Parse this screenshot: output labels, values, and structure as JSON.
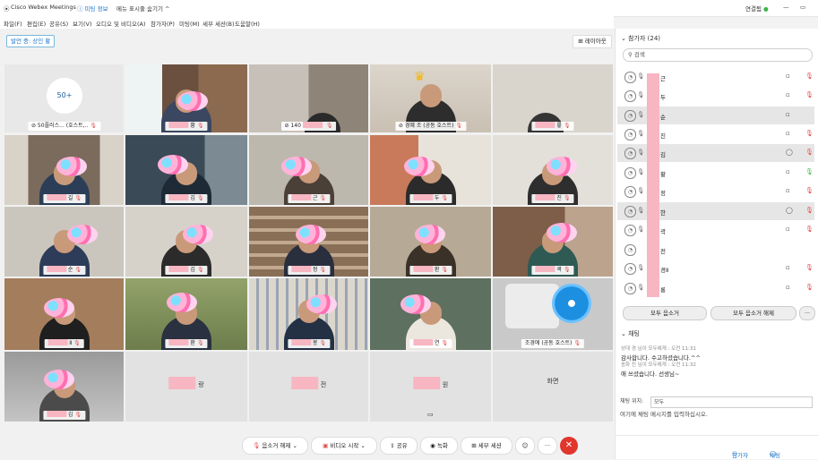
{
  "titlebar": {
    "app": "Cisco Webex Meetings",
    "meeting_info": "미팅 정보",
    "hide_menu": "메뉴 표시줄 숨기기 ^",
    "connection": "연결됨",
    "minimize": "—",
    "maximize": "▭"
  },
  "menu": [
    "파일(F)",
    "편집(E)",
    "공유(S)",
    "보기(V)",
    "오디오 및 비디오(A)",
    "참가자(P)",
    "미팅(M)",
    "세부 세션(B)",
    "도움말(H)"
  ],
  "speaking": "발언 중: 상인 황",
  "layout": "⊞ 레이아웃",
  "tiles": [
    {
      "name": "50플러스... (호스트,..",
      "logo_text": "50+"
    },
    {
      "name": "황"
    },
    {
      "name": "140"
    },
    {
      "name": "경혜 조 (공동 호스트)"
    },
    {
      "name": "릏"
    },
    {
      "name": "길"
    },
    {
      "name": "김"
    },
    {
      "name": "근"
    },
    {
      "name": "두"
    },
    {
      "name": "진"
    },
    {
      "name": "순"
    },
    {
      "name": "김"
    },
    {
      "name": "정"
    },
    {
      "name": "환"
    },
    {
      "name": "곽"
    },
    {
      "name": "Ⅱ"
    },
    {
      "name": "환"
    },
    {
      "name": "봉"
    },
    {
      "name": "연"
    },
    {
      "name": "조경애 (공동 호스트)"
    },
    {
      "name": "김"
    },
    {
      "name": "랑"
    },
    {
      "name": "전"
    },
    {
      "name": "원"
    },
    {
      "name": "화면"
    }
  ],
  "toolbar": {
    "mute": "음소거 해제",
    "video": "비디오 시작",
    "share": "공유",
    "record": "녹화",
    "breakout": "세부 세션",
    "emoji": "☺",
    "more": "···",
    "end": "✕"
  },
  "participants": {
    "header": "참가자 (24)",
    "search": "검색",
    "rows": [
      "근",
      "두",
      "순",
      "진",
      "김",
      "황",
      "정",
      "한",
      "곽",
      "전",
      "경Ⅱ",
      "룡"
    ],
    "mute_all": "모두 음소거",
    "unmute_all": "모두 음소거 해제",
    "more": "···"
  },
  "chat": {
    "header": "채팅",
    "messages": [
      {
        "meta": "상대 경 님이 모두에게 : 오전 11:31",
        "text": "감사합니다. 수고하셨습니다.^^"
      },
      {
        "meta": "송화 진 님이 모두에게 : 오전 11:32",
        "text": "애 쓰셨습니다. 선생님~"
      }
    ],
    "send_to_label": "채팅 위치:",
    "send_to_value": "모두",
    "input_placeholder": "여기에 채팅 메시지를 입력하십시오.",
    "participants_btn": "참가자",
    "chat_btn": "채팅"
  }
}
